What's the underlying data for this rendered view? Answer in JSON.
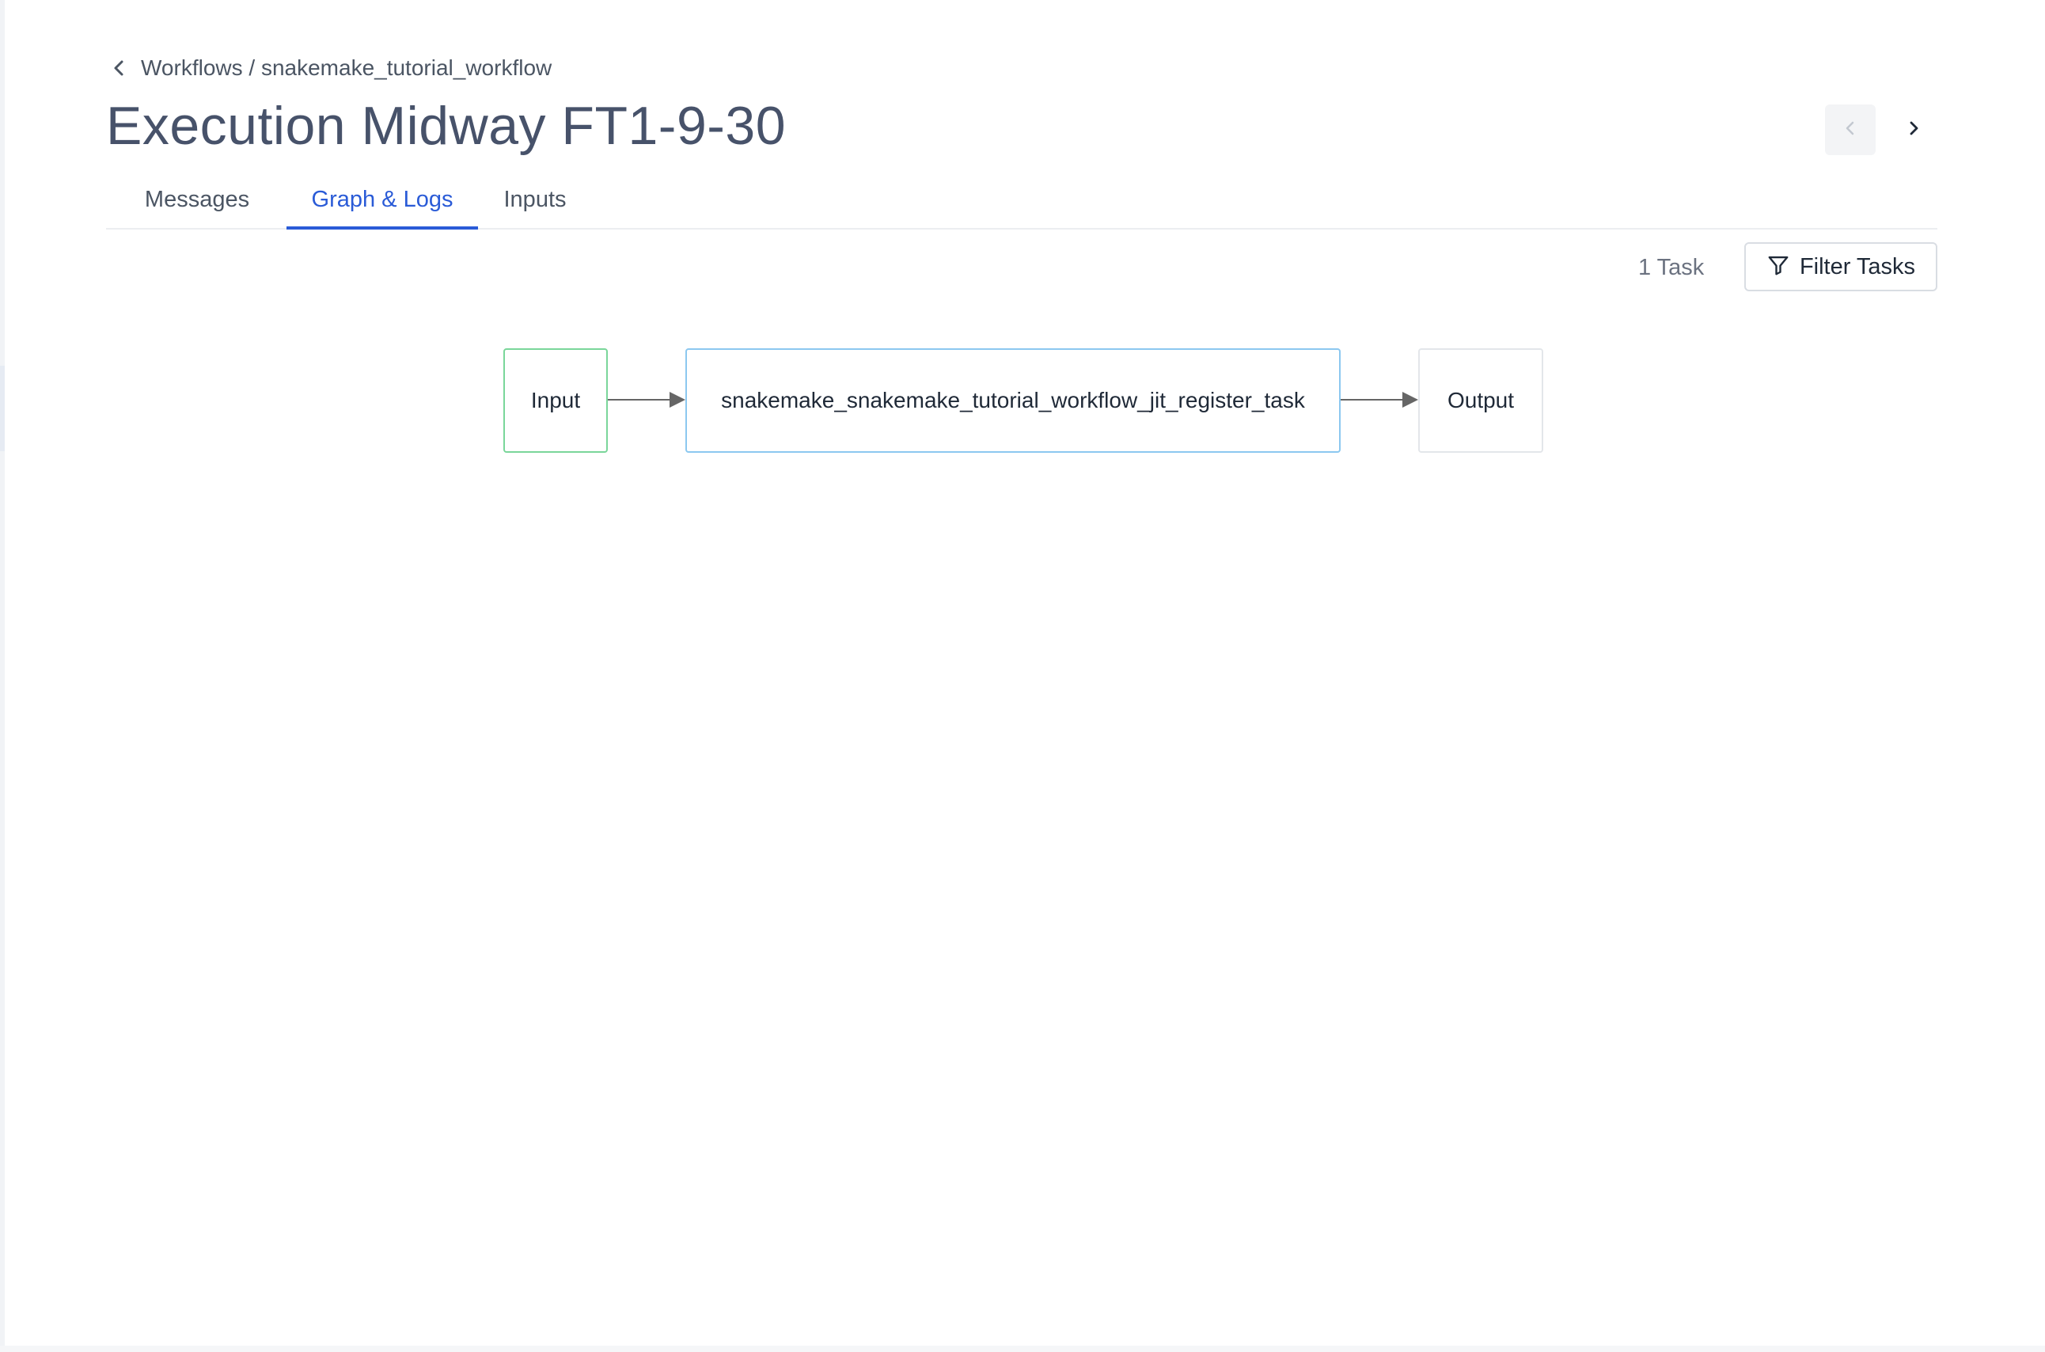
{
  "breadcrumb": {
    "text": "Workflows / snakemake_tutorial_workflow",
    "back_icon": "chevron-left-icon"
  },
  "page": {
    "title": "Execution Midway FT1-9-30"
  },
  "navigation": {
    "prev_icon": "chevron-left-icon",
    "next_icon": "chevron-right-icon"
  },
  "tabs": [
    {
      "label": "Messages",
      "active": false
    },
    {
      "label": "Graph & Logs",
      "active": true
    },
    {
      "label": "Inputs",
      "active": false
    }
  ],
  "toolbar": {
    "task_count": "1 Task",
    "filter_label": "Filter Tasks",
    "filter_icon": "filter-funnel-icon"
  },
  "graph": {
    "nodes": [
      {
        "id": "input",
        "label": "Input",
        "border_color": "#7ad69a"
      },
      {
        "id": "task",
        "label": "snakemake_snakemake_tutorial_workflow_jit_register_task",
        "border_color": "#8cc8f0"
      },
      {
        "id": "output",
        "label": "Output",
        "border_color": "#e3e6ea"
      }
    ],
    "edges": [
      {
        "from": "input",
        "to": "task"
      },
      {
        "from": "task",
        "to": "output"
      }
    ]
  },
  "colors": {
    "accent": "#2a5bd7",
    "title": "#47526a",
    "text": "#4b5563"
  }
}
